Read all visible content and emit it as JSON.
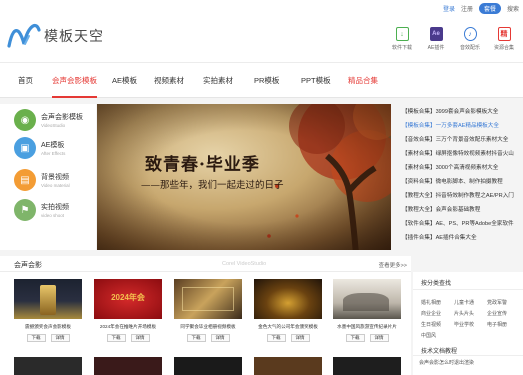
{
  "header": {
    "logo_text": "模板天空",
    "links": {
      "login": "登录",
      "register": "注册",
      "vip": "套餐",
      "search": "搜索"
    },
    "tools": [
      {
        "icon": "download-icon",
        "label": "软件下载",
        "color": "#4caf50"
      },
      {
        "icon": "ae-icon",
        "label": "AE插件",
        "color": "#4a3a8c",
        "glyph": "Ae"
      },
      {
        "icon": "audio-icon",
        "label": "音效配乐",
        "color": "#3a7bd5"
      },
      {
        "icon": "album-icon",
        "label": "资源合集",
        "color": "#e53935",
        "glyph": "精"
      }
    ]
  },
  "nav": {
    "items": [
      "首页",
      "会声会影模板",
      "AE模板",
      "视频素材",
      "实拍素材",
      "PR模板",
      "PPT模板",
      "精品合集"
    ],
    "active_index": 1,
    "hot_index": 7
  },
  "sidebar": {
    "items": [
      {
        "title": "会声会影模板",
        "sub": "VideoStudio",
        "color": "#6ab04c",
        "icon": "videostudio-icon"
      },
      {
        "title": "AE模板",
        "sub": "After Effects",
        "color": "#4a9fe0",
        "icon": "after-effects-icon"
      },
      {
        "title": "背景视频",
        "sub": "Video material",
        "color": "#f39c34",
        "icon": "video-material-icon"
      },
      {
        "title": "实拍视频",
        "sub": "video shoot",
        "color": "#7fb56a",
        "icon": "video-shoot-icon"
      }
    ]
  },
  "banner": {
    "title": "致青春·毕业季",
    "subtitle": "——那些年，我们一起走过的日子"
  },
  "news": [
    {
      "text": "【模板合集】3999套会声会影模板大全",
      "highlight": false
    },
    {
      "text": "【模板合集】一万多套AE精品模板大全",
      "highlight": true
    },
    {
      "text": "【音效合集】三万个背景音效配乐素材大全",
      "highlight": false
    },
    {
      "text": "【素材合集】绿屏抠像特效视频素材抖音火山",
      "highlight": false
    },
    {
      "text": "【素材合集】3000个高清视频素材大全",
      "highlight": false
    },
    {
      "text": "【资料合集】微电影脚本、制作拍摄教程",
      "highlight": false
    },
    {
      "text": "【教程大全】抖音特效制作教程之AE/PR入门",
      "highlight": false
    },
    {
      "text": "【教程大全】会声会影基础教程",
      "highlight": false
    },
    {
      "text": "【软件合集】AE、PS、PR等Adobe全家软件",
      "highlight": false
    },
    {
      "text": "【插件合集】AE插件合集大全",
      "highlight": false
    }
  ],
  "section": {
    "title": "会声会影",
    "watermark": "Corel VideoStudio",
    "more": "查看更多>>"
  },
  "cards": [
    {
      "caption": "震撼颁奖会声会影模板",
      "download": "下载",
      "detail": "详情",
      "palette": [
        "#1c2230",
        "#a88a3c"
      ]
    },
    {
      "caption": "2024年会在推唯片开场模板",
      "download": "下载",
      "detail": "详情",
      "palette": [
        "#b8141a",
        "#f2c14e"
      ],
      "thumb_text": "2024年会"
    },
    {
      "caption": "同学聚会毕业相册视频模板",
      "download": "下载",
      "detail": "详情",
      "palette": [
        "#3a2a1a",
        "#c9a35c"
      ]
    },
    {
      "caption": "金色大气的公司年会颁奖模板",
      "download": "下载",
      "detail": "详情",
      "palette": [
        "#20140a",
        "#d4a032"
      ]
    },
    {
      "caption": "水墨中国风旅游宣传纪录片片",
      "download": "下载",
      "detail": "详情",
      "palette": [
        "#dcd6cc",
        "#5a564e"
      ]
    }
  ],
  "right_panel": {
    "title": "按分类查找",
    "links": [
      "婚礼相册",
      "儿童卡通",
      "党政军警",
      "商业企业",
      "片头片头",
      "企业宣传",
      "生日视频",
      "毕业学校",
      "电子相册",
      "中国风"
    ],
    "title2": "技术文档教程",
    "line": "会声会影怎么时退出渲染"
  }
}
